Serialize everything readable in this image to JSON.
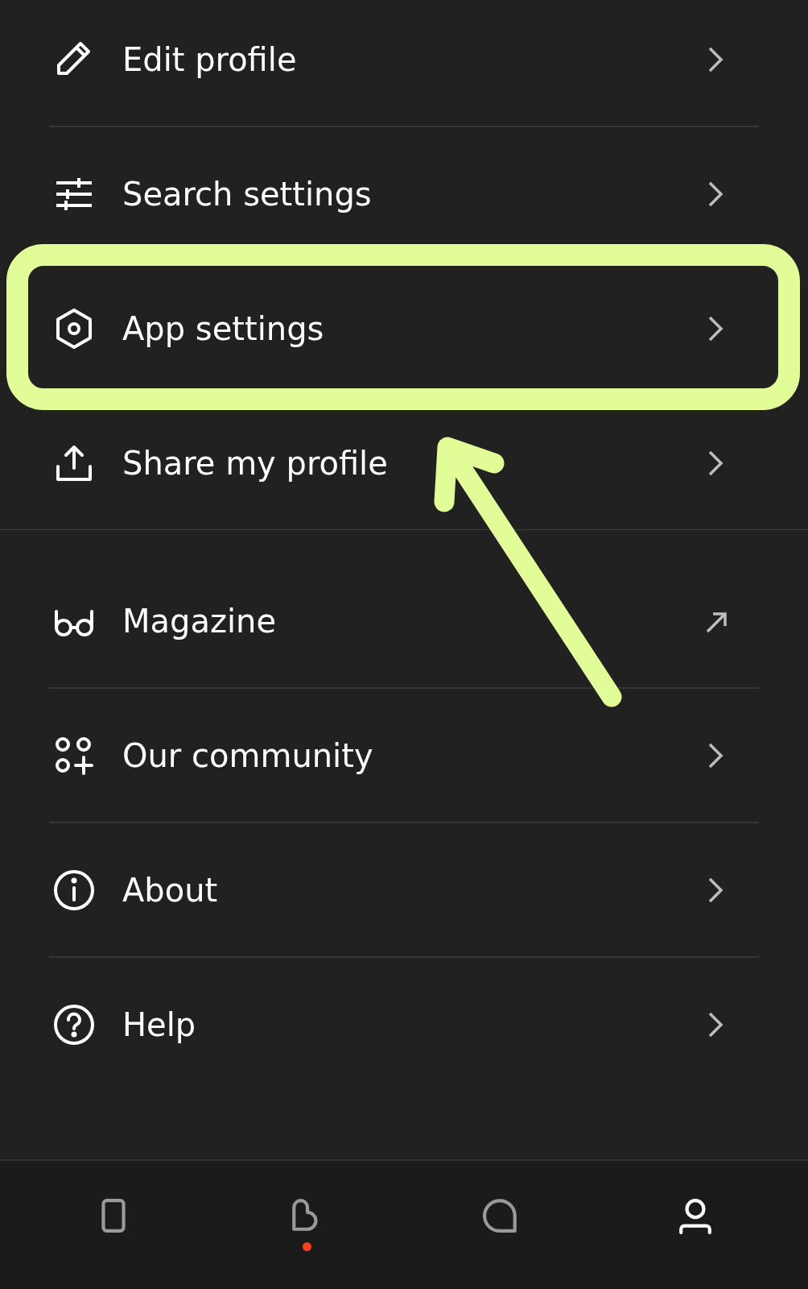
{
  "sections": [
    {
      "items": [
        {
          "label": "Edit profile",
          "kind": "link",
          "highlighted": false
        },
        {
          "label": "Search settings",
          "kind": "link",
          "highlighted": false
        },
        {
          "label": "App settings",
          "kind": "link",
          "highlighted": true
        },
        {
          "label": "Share my profile",
          "kind": "link",
          "highlighted": false
        }
      ]
    },
    {
      "items": [
        {
          "label": "Magazine",
          "kind": "external",
          "highlighted": false
        },
        {
          "label": "Our community",
          "kind": "link",
          "highlighted": false
        },
        {
          "label": "About",
          "kind": "link",
          "highlighted": false
        },
        {
          "label": "Help",
          "kind": "link",
          "highlighted": false
        }
      ]
    }
  ],
  "bottom_nav": [
    {
      "selected": false,
      "badge": false
    },
    {
      "selected": false,
      "badge": true
    },
    {
      "selected": false,
      "badge": false
    },
    {
      "selected": true,
      "badge": false
    }
  ]
}
